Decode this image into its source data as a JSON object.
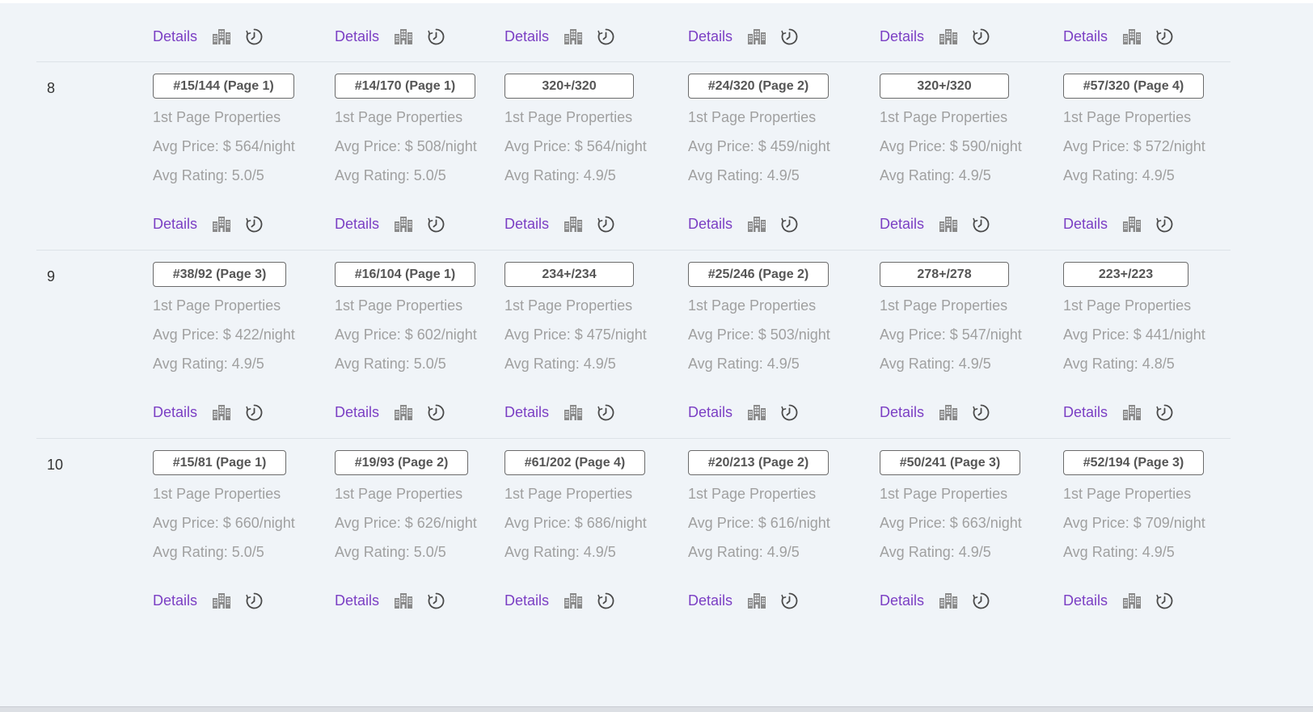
{
  "top_actions": [
    {
      "details": "Details"
    },
    {
      "details": "Details"
    },
    {
      "details": "Details"
    },
    {
      "details": "Details"
    },
    {
      "details": "Details"
    },
    {
      "details": "Details"
    }
  ],
  "rows": [
    {
      "rank": "8",
      "cells": [
        {
          "badge": "#15/144 (Page 1)",
          "props": "1st Page Properties",
          "price": "Avg Price: $ 564/night",
          "rating": "Avg Rating: 5.0/5",
          "details": "Details"
        },
        {
          "badge": "#14/170 (Page 1)",
          "props": "1st Page Properties",
          "price": "Avg Price: $ 508/night",
          "rating": "Avg Rating: 5.0/5",
          "details": "Details"
        },
        {
          "badge": "320+/320",
          "props": "1st Page Properties",
          "price": "Avg Price: $ 564/night",
          "rating": "Avg Rating: 4.9/5",
          "details": "Details"
        },
        {
          "badge": "#24/320 (Page 2)",
          "props": "1st Page Properties",
          "price": "Avg Price: $ 459/night",
          "rating": "Avg Rating: 4.9/5",
          "details": "Details"
        },
        {
          "badge": "320+/320",
          "props": "1st Page Properties",
          "price": "Avg Price: $ 590/night",
          "rating": "Avg Rating: 4.9/5",
          "details": "Details"
        },
        {
          "badge": "#57/320 (Page 4)",
          "props": "1st Page Properties",
          "price": "Avg Price: $ 572/night",
          "rating": "Avg Rating: 4.9/5",
          "details": "Details"
        }
      ]
    },
    {
      "rank": "9",
      "cells": [
        {
          "badge": "#38/92 (Page 3)",
          "props": "1st Page Properties",
          "price": "Avg Price: $ 422/night",
          "rating": "Avg Rating: 4.9/5",
          "details": "Details"
        },
        {
          "badge": "#16/104 (Page 1)",
          "props": "1st Page Properties",
          "price": "Avg Price: $ 602/night",
          "rating": "Avg Rating: 5.0/5",
          "details": "Details"
        },
        {
          "badge": "234+/234",
          "props": "1st Page Properties",
          "price": "Avg Price: $ 475/night",
          "rating": "Avg Rating: 4.9/5",
          "details": "Details"
        },
        {
          "badge": "#25/246 (Page 2)",
          "props": "1st Page Properties",
          "price": "Avg Price: $ 503/night",
          "rating": "Avg Rating: 4.9/5",
          "details": "Details"
        },
        {
          "badge": "278+/278",
          "props": "1st Page Properties",
          "price": "Avg Price: $ 547/night",
          "rating": "Avg Rating: 4.9/5",
          "details": "Details"
        },
        {
          "badge": "223+/223",
          "props": "1st Page Properties",
          "price": "Avg Price: $ 441/night",
          "rating": "Avg Rating: 4.8/5",
          "details": "Details"
        }
      ]
    },
    {
      "rank": "10",
      "cells": [
        {
          "badge": "#15/81 (Page 1)",
          "props": "1st Page Properties",
          "price": "Avg Price: $ 660/night",
          "rating": "Avg Rating: 5.0/5",
          "details": "Details"
        },
        {
          "badge": "#19/93 (Page 2)",
          "props": "1st Page Properties",
          "price": "Avg Price: $ 626/night",
          "rating": "Avg Rating: 5.0/5",
          "details": "Details"
        },
        {
          "badge": "#61/202 (Page 4)",
          "props": "1st Page Properties",
          "price": "Avg Price: $ 686/night",
          "rating": "Avg Rating: 4.9/5",
          "details": "Details"
        },
        {
          "badge": "#20/213 (Page 2)",
          "props": "1st Page Properties",
          "price": "Avg Price: $ 616/night",
          "rating": "Avg Rating: 4.9/5",
          "details": "Details"
        },
        {
          "badge": "#50/241 (Page 3)",
          "props": "1st Page Properties",
          "price": "Avg Price: $ 663/night",
          "rating": "Avg Rating: 4.9/5",
          "details": "Details"
        },
        {
          "badge": "#52/194 (Page 3)",
          "props": "1st Page Properties",
          "price": "Avg Price: $ 709/night",
          "rating": "Avg Rating: 4.9/5",
          "details": "Details"
        }
      ]
    }
  ],
  "icons": {
    "building": "building-icon",
    "history": "history-icon"
  },
  "colors": {
    "link": "#7b3fc4",
    "muted_text": "#a0a0a0",
    "background": "#f0f4f8"
  }
}
